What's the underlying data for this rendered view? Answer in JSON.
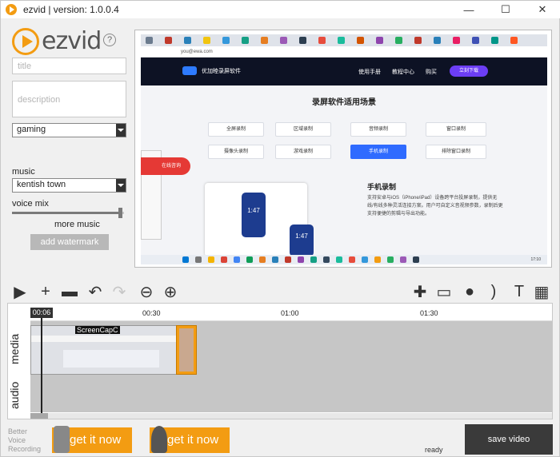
{
  "window": {
    "title": "ezvid | version: 1.0.0.4"
  },
  "brand": {
    "logo_text": "ezvid",
    "help_glyph": "?"
  },
  "left_panel": {
    "title_placeholder": "title",
    "description_placeholder": "description",
    "category_value": "gaming",
    "music_label": "music",
    "music_value": "kentish town",
    "voice_mix_label": "voice mix",
    "voice_mix_level": 0.97,
    "more_music_label": "more music",
    "add_watermark_label": "add watermark"
  },
  "preview": {
    "url": "you@ewa.com",
    "site_brand": "优加睦录屏软件",
    "nav_items": [
      "使用手册",
      "教程中心",
      "购买"
    ],
    "download_label": "立刻下载",
    "heading": "录屏软件适用场景",
    "chips": [
      "全屏录制",
      "区域录制",
      "音频录制",
      "窗口录制",
      "摄像头录制",
      "游戏录制",
      "手机录制",
      "排除窗口录制"
    ],
    "active_chip": "手机录制",
    "consult_label": "在线咨询",
    "phone_time": "1:47",
    "section_title": "手机录制",
    "section_text": "支持安卓与iOS（iPhone/iPad）设备跨平台投屏录制，提供无线/有线多种灵活连接方案。用户可自定义音视频参数，录制后更支持便捷的剪辑与导出功能。",
    "taskbar_clock": "17:10"
  },
  "toolbar": {
    "tools": [
      {
        "name": "play-icon",
        "glyph": "▶"
      },
      {
        "name": "add-file-icon",
        "glyph": "+"
      },
      {
        "name": "open-folder-icon",
        "glyph": "▬"
      },
      {
        "name": "undo-icon",
        "glyph": "↶"
      },
      {
        "name": "redo-icon",
        "glyph": "↷"
      },
      {
        "name": "zoom-out-icon",
        "glyph": "⊖"
      },
      {
        "name": "zoom-in-icon",
        "glyph": "⊕"
      },
      {
        "name": "gamepad-icon",
        "glyph": "✚"
      },
      {
        "name": "monitor-icon",
        "glyph": "▭"
      },
      {
        "name": "microphone-icon",
        "glyph": "●"
      },
      {
        "name": "speech-icon",
        "glyph": ")"
      },
      {
        "name": "text-icon",
        "glyph": "T"
      },
      {
        "name": "film-icon",
        "glyph": "▦"
      }
    ]
  },
  "timeline": {
    "cursor_time": "00:06",
    "ticks": [
      "00:30",
      "01:00",
      "01:30"
    ],
    "tracks": [
      "media",
      "audio"
    ],
    "clip_label": "ScreenCapC"
  },
  "bottom": {
    "better_voice_label": "Better\nVoice\nRecording",
    "promo1_label": "get it now",
    "promo2_label": "get it now",
    "status": "ready",
    "save_label": "save video"
  },
  "colors": {
    "accent": "#f39c12",
    "dark": "#3a3a3a",
    "track": "#c6c6c6",
    "chip_active": "#2f6bff"
  }
}
